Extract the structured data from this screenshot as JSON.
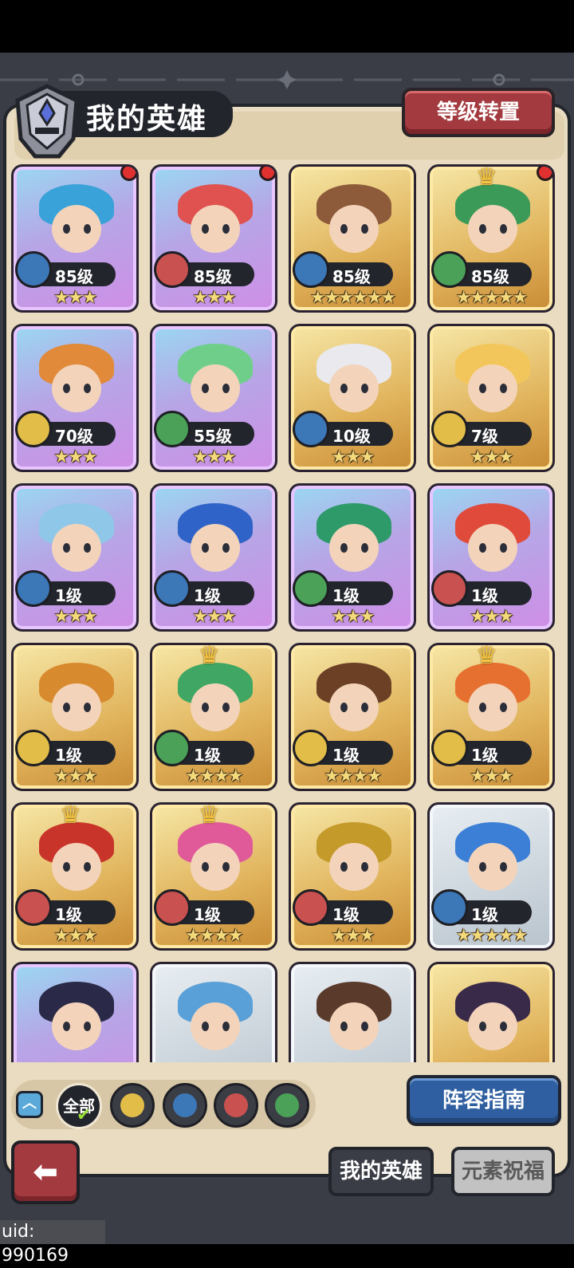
{
  "header": {
    "title": "我的英雄",
    "reset_label": "等级转置"
  },
  "heroes": [
    {
      "level": "85级",
      "stars": "★★★",
      "element": "water",
      "frame": "purple",
      "hair": "#39a2d9",
      "reddot": true,
      "crown": false
    },
    {
      "level": "85级",
      "stars": "★★★",
      "element": "fire",
      "frame": "purple",
      "hair": "#e0524f",
      "reddot": true,
      "crown": false
    },
    {
      "level": "85级",
      "stars": "★★★★★★",
      "element": "water",
      "frame": "gold",
      "hair": "#8d5b3a",
      "reddot": false,
      "crown": false
    },
    {
      "level": "85级",
      "stars": "★★★★★",
      "element": "nature",
      "frame": "gold",
      "hair": "#3c9a58",
      "reddot": true,
      "crown": true
    },
    {
      "level": "70级",
      "stars": "★★★",
      "element": "earth",
      "frame": "purple",
      "hair": "#e08a3a",
      "reddot": false,
      "crown": false
    },
    {
      "level": "55级",
      "stars": "★★★",
      "element": "nature",
      "frame": "purple",
      "hair": "#6fcf8a",
      "reddot": false,
      "crown": false
    },
    {
      "level": "10级",
      "stars": "★★★",
      "element": "water",
      "frame": "gold",
      "hair": "#e9e9ee",
      "reddot": false,
      "crown": false
    },
    {
      "level": "7级",
      "stars": "★★★",
      "element": "earth",
      "frame": "gold",
      "hair": "#f2c65a",
      "reddot": false,
      "crown": false
    },
    {
      "level": "1级",
      "stars": "★★★",
      "element": "water",
      "frame": "purple",
      "hair": "#8fc7e9",
      "reddot": false,
      "crown": false
    },
    {
      "level": "1级",
      "stars": "★★★",
      "element": "water",
      "frame": "purple",
      "hair": "#2f63c7",
      "reddot": false,
      "crown": false
    },
    {
      "level": "1级",
      "stars": "★★★",
      "element": "nature",
      "frame": "purple",
      "hair": "#2e9a6a",
      "reddot": false,
      "crown": false
    },
    {
      "level": "1级",
      "stars": "★★★",
      "element": "fire",
      "frame": "purple",
      "hair": "#e04a3a",
      "reddot": false,
      "crown": false
    },
    {
      "level": "1级",
      "stars": "★★★",
      "element": "earth",
      "frame": "gold",
      "hair": "#d88a2e",
      "reddot": false,
      "crown": false
    },
    {
      "level": "1级",
      "stars": "★★★★",
      "element": "nature",
      "frame": "gold",
      "hair": "#3fa763",
      "reddot": false,
      "crown": true
    },
    {
      "level": "1级",
      "stars": "★★★★",
      "element": "earth",
      "frame": "gold",
      "hair": "#6b4025",
      "reddot": false,
      "crown": false
    },
    {
      "level": "1级",
      "stars": "★★★",
      "element": "earth",
      "frame": "gold",
      "hair": "#e6702f",
      "reddot": false,
      "crown": true
    },
    {
      "level": "1级",
      "stars": "★★★",
      "element": "fire",
      "frame": "gold",
      "hair": "#c8342a",
      "reddot": false,
      "crown": true
    },
    {
      "level": "1级",
      "stars": "★★★★",
      "element": "fire",
      "frame": "gold",
      "hair": "#e05a9a",
      "reddot": false,
      "crown": true
    },
    {
      "level": "1级",
      "stars": "★★★",
      "element": "fire",
      "frame": "gold",
      "hair": "#c49a2a",
      "reddot": false,
      "crown": false
    },
    {
      "level": "1级",
      "stars": "★★★★★",
      "element": "water",
      "frame": "silver",
      "hair": "#3b7fd6",
      "reddot": false,
      "crown": false
    },
    {
      "level": "",
      "stars": "",
      "element": "none",
      "frame": "purple",
      "hair": "#2a2a48",
      "reddot": false,
      "crown": false
    },
    {
      "level": "",
      "stars": "",
      "element": "none",
      "frame": "silver",
      "hair": "#5aa0d8",
      "reddot": false,
      "crown": false
    },
    {
      "level": "",
      "stars": "",
      "element": "none",
      "frame": "silver",
      "hair": "#5a3a2a",
      "reddot": false,
      "crown": false
    },
    {
      "level": "",
      "stars": "",
      "element": "none",
      "frame": "gold",
      "hair": "#3a2a4a",
      "reddot": false,
      "crown": false
    }
  ],
  "filters": {
    "all_label": "全部",
    "elements": [
      "earth",
      "water",
      "fire",
      "nature"
    ]
  },
  "guide_label": "阵容指南",
  "tabs": {
    "mine": "我的英雄",
    "blessing": "元素祝福"
  },
  "uid_text": "uid: 990169",
  "colors": {
    "water": "#3c77b8",
    "fire": "#c95150",
    "nature": "#4aa157",
    "earth": "#e2bd48"
  }
}
